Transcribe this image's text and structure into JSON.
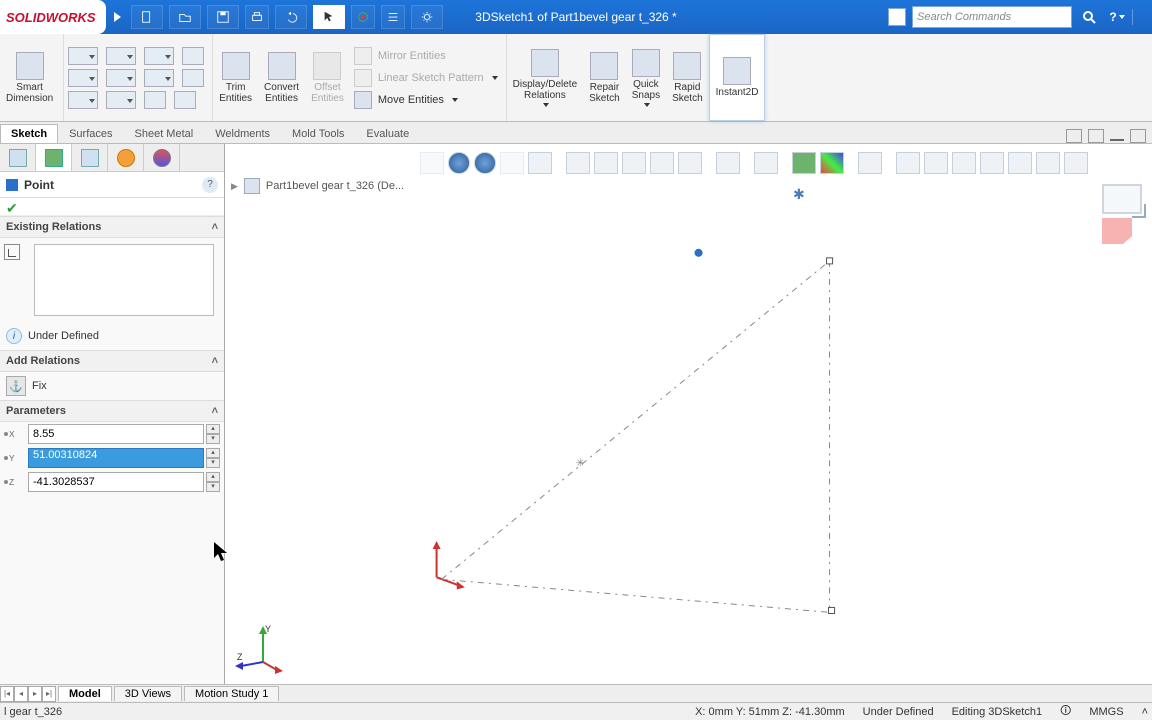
{
  "title": "3DSketch1 of Part1bevel gear t_326 *",
  "logo": "SOLIDWORKS",
  "search_placeholder": "Search Commands",
  "ribbon": {
    "smart_dim": "Smart\nDimension",
    "trim": "Trim\nEntities",
    "convert": "Convert\nEntities",
    "offset": "Offset\nEntities",
    "mirror": "Mirror Entities",
    "linear": "Linear Sketch Pattern",
    "move": "Move Entities",
    "display": "Display/Delete\nRelations",
    "repair": "Repair\nSketch",
    "quick": "Quick\nSnaps",
    "rapid": "Rapid\nSketch",
    "instant": "Instant2D"
  },
  "feature_tabs": [
    "Sketch",
    "Surfaces",
    "Sheet Metal",
    "Weldments",
    "Mold Tools",
    "Evaluate"
  ],
  "breadcrumb": "Part1bevel gear t_326  (De...",
  "panel": {
    "title": "Point",
    "existing": "Existing Relations",
    "status": "Under Defined",
    "add": "Add Relations",
    "fix": "Fix",
    "parameters": "Parameters",
    "x": "8.55",
    "y": "51.00310824",
    "z": "-41.3028537"
  },
  "bottom_tabs": [
    "Model",
    "3D Views",
    "Motion Study 1"
  ],
  "status": {
    "file": "l gear t_326",
    "coords": "X: 0mm Y: 51mm Z: -41.30mm",
    "def": "Under Defined",
    "edit": "Editing 3DSketch1",
    "units": "MMGS"
  },
  "triad_labels": {
    "y": "Y",
    "z": "Z"
  }
}
